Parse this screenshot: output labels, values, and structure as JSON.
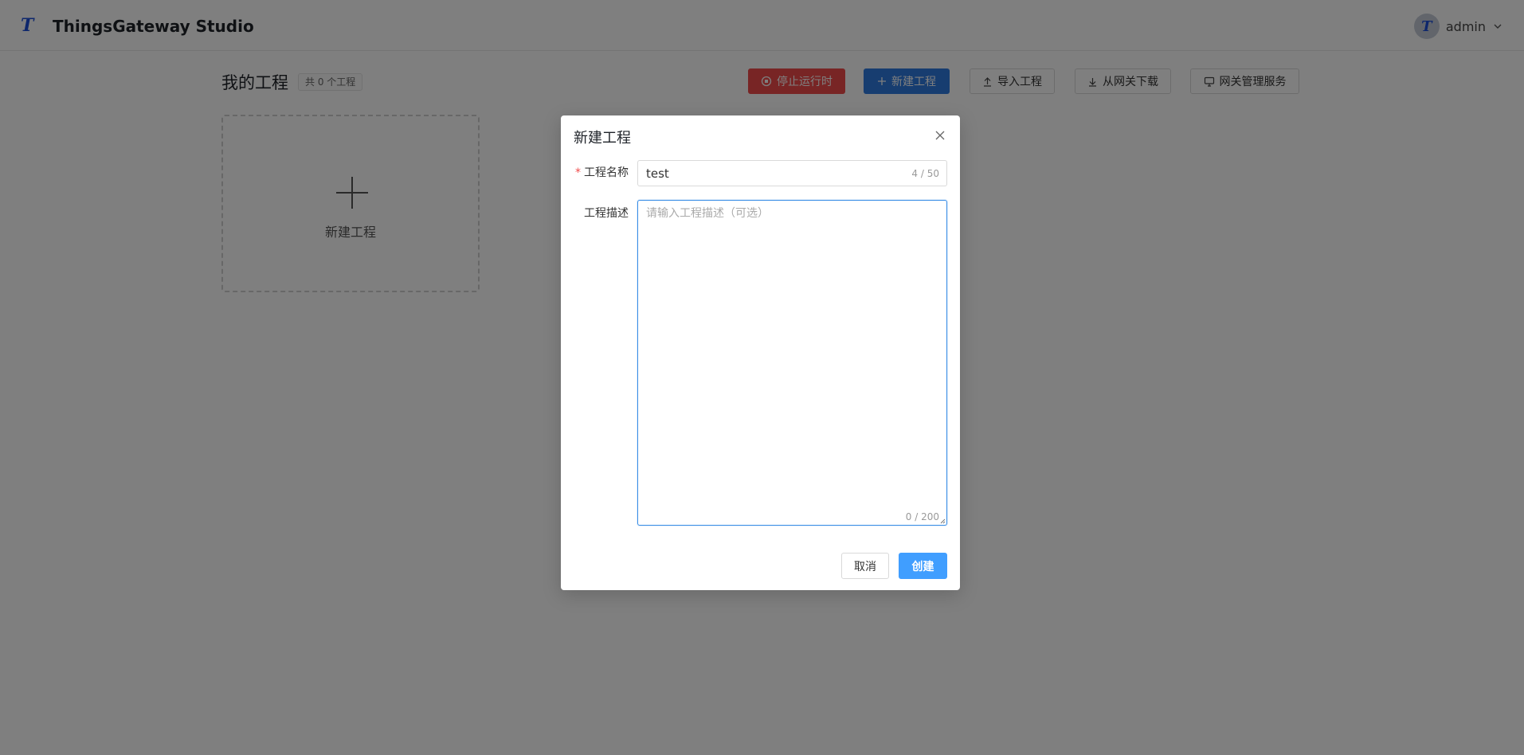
{
  "topbar": {
    "app_title": "ThingsGateway Studio",
    "user_name": "admin"
  },
  "page": {
    "title": "我的工程",
    "count_tag": "共 0 个工程",
    "buttons": {
      "stop_runtime": "停止运行时",
      "new_project": "新建工程",
      "import_project": "导入工程",
      "download_from_gateway": "从网关下载",
      "gateway_service": "网关管理服务"
    },
    "new_card_label": "新建工程"
  },
  "dialog": {
    "title": "新建工程",
    "name_label": "工程名称",
    "name_value": "test",
    "name_counter": "4 / 50",
    "desc_label": "工程描述",
    "desc_placeholder": "请输入工程描述（可选）",
    "desc_counter": "0 / 200",
    "cancel_label": "取消",
    "create_label": "创建"
  },
  "colors": {
    "danger": "#f04b4b",
    "primary": "#2f7be0",
    "create": "#409eff",
    "focus": "#3a8ee6"
  }
}
